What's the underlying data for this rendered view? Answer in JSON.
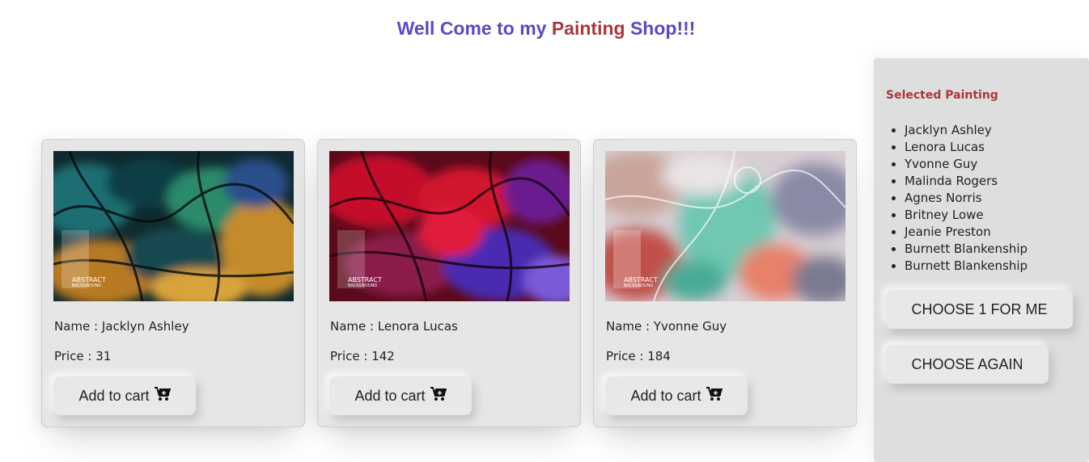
{
  "header": {
    "title_part1": "Well Come to my ",
    "title_accent": "Painting",
    "title_part2": " Shop!!!"
  },
  "colors": {
    "title": "#5a4ac4",
    "accent": "#a9383c",
    "card_bg": "#e6e6e6",
    "panel_bg": "#dedede"
  },
  "cards": [
    {
      "name_prefix": "Name : ",
      "name": "Jacklyn Ashley",
      "price_prefix": "Price : ",
      "price": "31",
      "button_label": "Add to cart",
      "image_text_1": "ABSTRACT",
      "image_text_2": "BACKGROUND"
    },
    {
      "name_prefix": "Name : ",
      "name": "Lenora Lucas",
      "price_prefix": "Price : ",
      "price": "142",
      "button_label": "Add to cart",
      "image_text_1": "ABSTRACT",
      "image_text_2": "BACKGROUND"
    },
    {
      "name_prefix": "Name : ",
      "name": "Yvonne Guy",
      "price_prefix": "Price : ",
      "price": "184",
      "button_label": "Add to cart",
      "image_text_1": "ABSTRACT",
      "image_text_2": "BACKGROUND"
    }
  ],
  "panel": {
    "heading": "Selected Painting",
    "items": [
      "Jacklyn Ashley",
      "Lenora Lucas",
      "Yvonne Guy",
      "Malinda Rogers",
      "Agnes Norris",
      "Britney Lowe",
      "Jeanie Preston",
      "Burnett Blankenship",
      "Burnett Blankenship"
    ],
    "choose_one_label": "CHOOSE 1 FOR ME",
    "choose_again_label": "CHOOSE AGAIN"
  },
  "icons": {
    "cart": "cart-plus-icon",
    "bullet": "disc"
  }
}
